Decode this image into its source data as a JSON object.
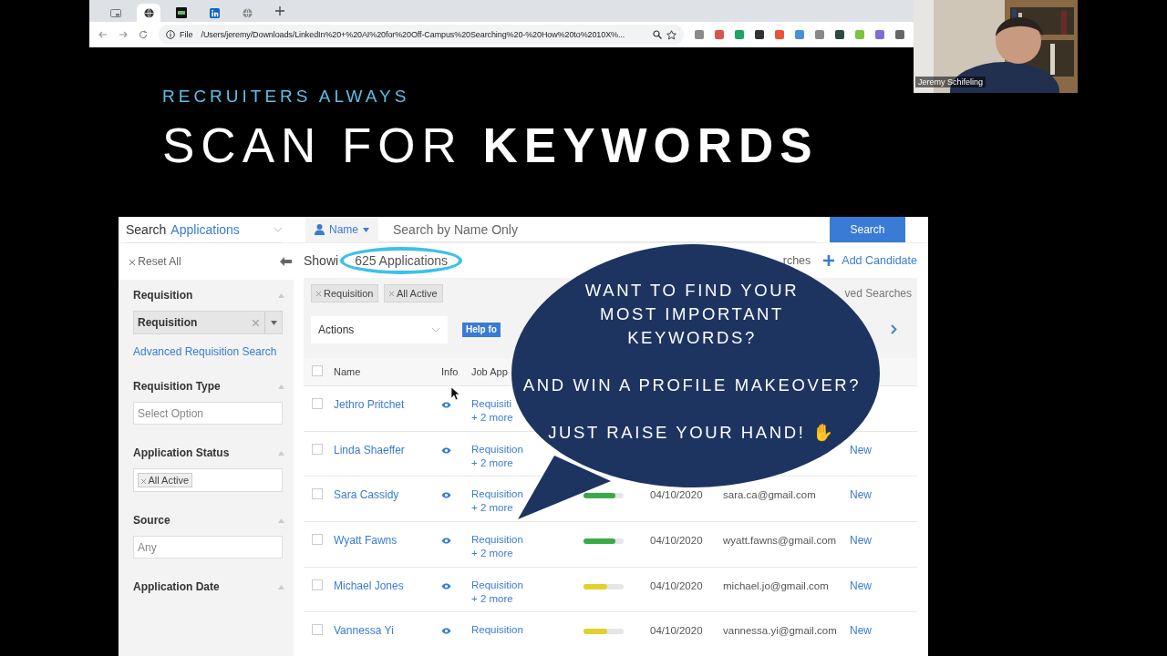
{
  "browser": {
    "tabs": [
      {
        "kind": "window",
        "selected": false
      },
      {
        "kind": "globe",
        "selected": true
      },
      {
        "kind": "dark",
        "selected": false
      },
      {
        "kind": "network",
        "selected": false
      },
      {
        "kind": "globe",
        "selected": false
      }
    ],
    "file_label": "File",
    "url": "/Users/jeremy/Downloads/LinkedIn%20+%20AI%20for%20Off-Campus%20Searching%20-%20How%20to%2010X%..."
  },
  "webcam": {
    "name": "Jeremy Schifeling"
  },
  "slide": {
    "subtitle": "RECRUITERS ALWAYS",
    "title": "SCAN FOR **KEYWORDS**"
  },
  "ats": {
    "scope_label": "Search",
    "scope_value": "Applications",
    "name_filter": "Name",
    "search_placeholder": "Search by Name Only",
    "search_button": "Search",
    "reset": "Reset All",
    "sections": [
      {
        "title": "Requisition",
        "controls": [
          {
            "kind": "select",
            "value": "Requisition"
          },
          {
            "kind": "link",
            "label": "Advanced Requisition Search"
          }
        ]
      },
      {
        "title": "Requisition Type",
        "controls": [
          {
            "kind": "input",
            "placeholder": "Select Option"
          }
        ]
      },
      {
        "title": "Application Status",
        "controls": [
          {
            "kind": "tags",
            "tags": [
              "All Active"
            ]
          }
        ]
      },
      {
        "title": "Source",
        "controls": [
          {
            "kind": "input",
            "placeholder": "Any"
          }
        ]
      },
      {
        "title": "Application Date"
      }
    ],
    "showing": "Showi",
    "count": "625 Applications",
    "saved": "rches",
    "add_candidate": "Add Candidate",
    "chips": [
      "Requisition",
      "All Active"
    ],
    "saved_searches": "ved Searches",
    "actions": "Actions",
    "help": "Help fo",
    "columns": [
      "Name",
      "Info",
      "Job App"
    ],
    "header_checked": false,
    "rows": [
      {
        "name": "Jethro Pritchet",
        "checked": false,
        "job": "Requisiti",
        "more": "+ 2 more"
      },
      {
        "name": "Linda Shaeffer",
        "checked": false,
        "job": "Requisition",
        "more": "+ 2 more",
        "status": "New"
      },
      {
        "name": "Sara Cassidy",
        "checked": false,
        "job": "Requisition",
        "more": "+ 2 more",
        "score": {
          "level": 0.8,
          "color": "#3aaa48"
        },
        "date": "04/10/2020",
        "email": "sara.ca@gmail.com",
        "status": "New"
      },
      {
        "name": "Wyatt Fawns",
        "checked": false,
        "job": "Requisition",
        "more": "+ 2 more",
        "score": {
          "level": 0.8,
          "color": "#3aaa48"
        },
        "date": "04/10/2020",
        "email": "wyatt.fawns@gmail.com",
        "status": "New"
      },
      {
        "name": "Michael Jones",
        "checked": false,
        "job": "Requisition",
        "more": "+ 2 more",
        "score": {
          "level": 0.6,
          "color": "#e2d12a"
        },
        "date": "04/10/2020",
        "email": "michael.jo@gmail.com",
        "status": "New"
      },
      {
        "name": "Vannessa Yi",
        "checked": false,
        "job": "Requisition",
        "score": {
          "level": 0.6,
          "color": "#e2d12a"
        },
        "date": "04/10/2020",
        "email": "vannessa.yi@gmail.com",
        "status": "New"
      }
    ]
  },
  "bubble": {
    "lines": [
      "WANT TO FIND YOUR",
      "MOST IMPORTANT",
      "KEYWORDS?"
    ],
    "line2": "AND WIN A PROFILE MAKEOVER?",
    "line3": "JUST RAISE YOUR HAND! ✋"
  }
}
